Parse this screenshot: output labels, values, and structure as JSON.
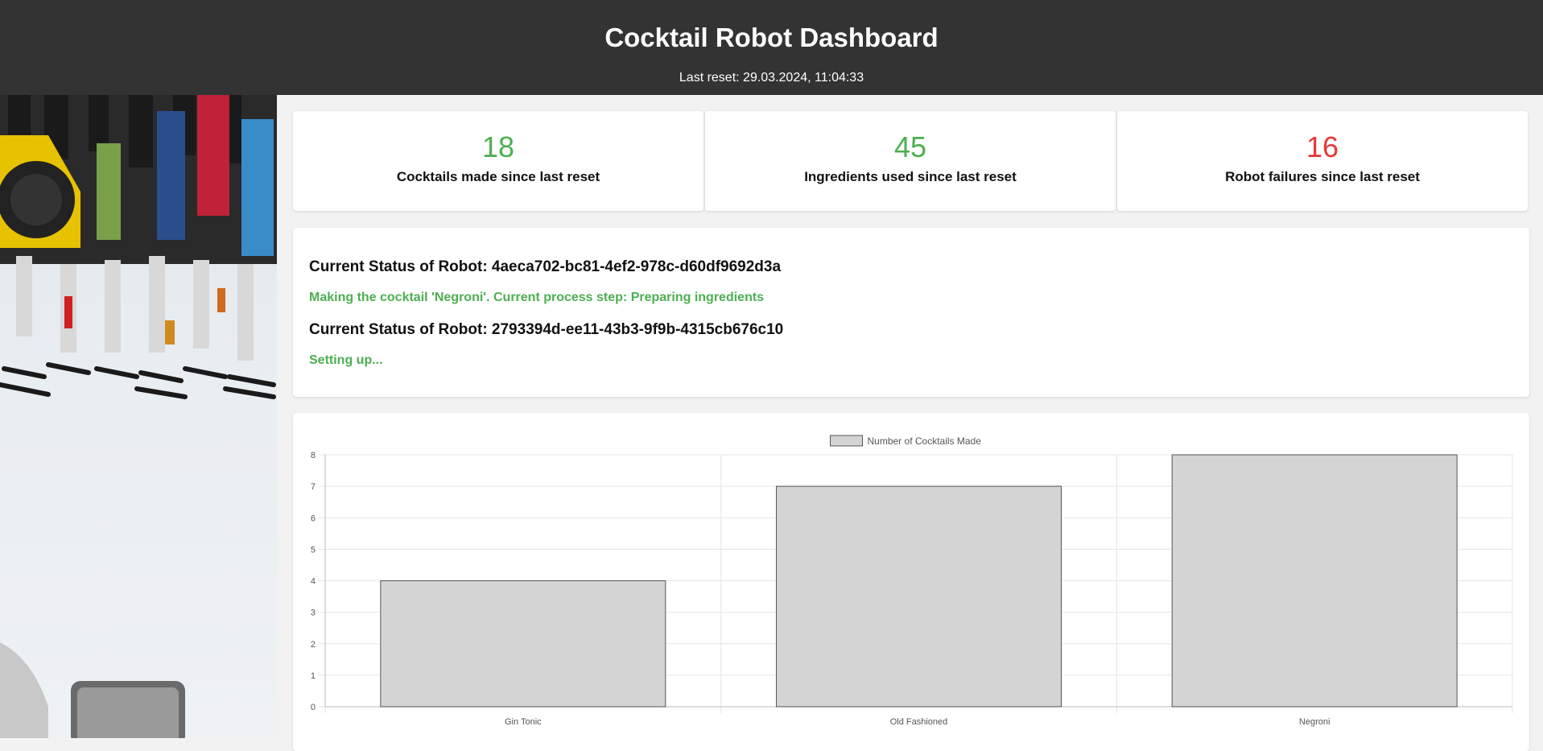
{
  "header": {
    "title": "Cocktail Robot Dashboard",
    "last_reset": "Last reset: 29.03.2024, 11:04:33"
  },
  "stats": [
    {
      "value": "18",
      "label": "Cocktails made since last reset",
      "color": "#4caf50"
    },
    {
      "value": "45",
      "label": "Ingredients used since last reset",
      "color": "#4caf50"
    },
    {
      "value": "16",
      "label": "Robot failures since last reset",
      "color": "#e53935"
    }
  ],
  "robots": [
    {
      "title": "Current Status of Robot: 4aeca702-bc81-4ef2-978c-d60df9692d3a",
      "message": "Making the cocktail 'Negroni'. Current process step: Preparing ingredients"
    },
    {
      "title": "Current Status of Robot: 2793394d-ee11-43b3-9f9b-4315cb676c10",
      "message": "Setting up..."
    }
  ],
  "chart_data": {
    "type": "bar",
    "categories": [
      "Gin Tonic",
      "Old Fashioned",
      "Negroni"
    ],
    "series": [
      {
        "name": "Number of Cocktails Made",
        "values": [
          4,
          7,
          8
        ]
      }
    ],
    "ylim": [
      0,
      8
    ],
    "yticks": [
      "0",
      "1",
      "2",
      "3",
      "4",
      "5",
      "6",
      "7",
      "8"
    ],
    "grid": true,
    "legend": "top-center",
    "bar_color": "#d4d4d4"
  }
}
